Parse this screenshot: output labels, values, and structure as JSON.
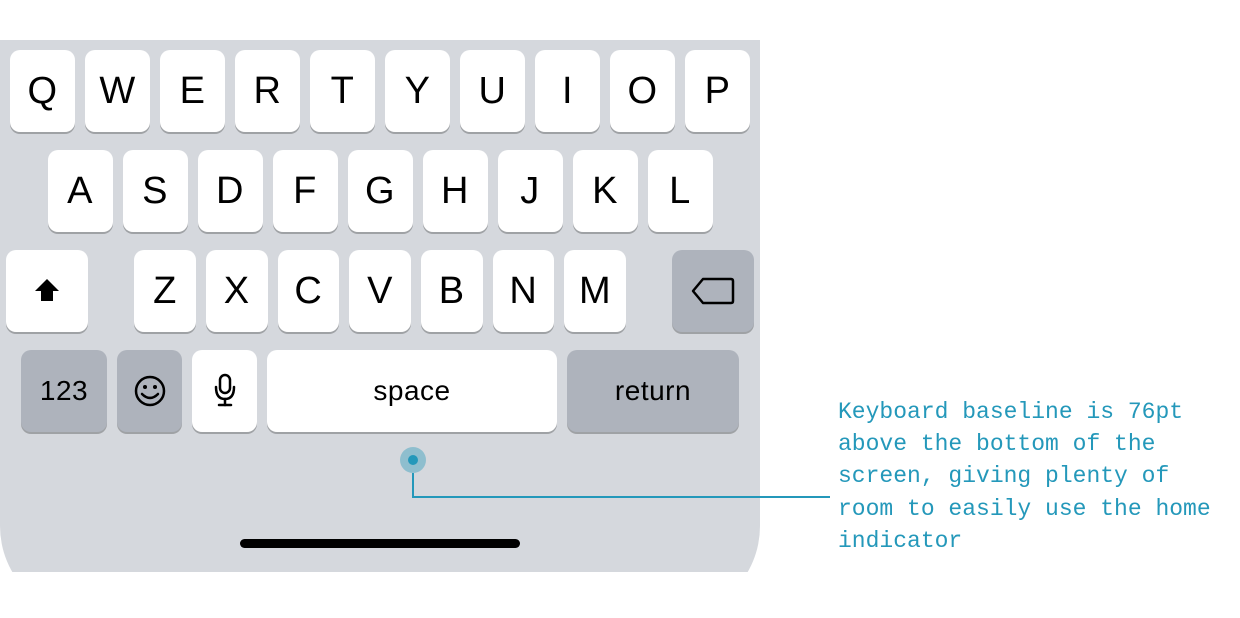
{
  "keyboard": {
    "row1": [
      "Q",
      "W",
      "E",
      "R",
      "T",
      "Y",
      "U",
      "I",
      "O",
      "P"
    ],
    "row2": [
      "A",
      "S",
      "D",
      "F",
      "G",
      "H",
      "J",
      "K",
      "L"
    ],
    "row3": [
      "Z",
      "X",
      "C",
      "V",
      "B",
      "N",
      "M"
    ],
    "numkey": "123",
    "space": "space",
    "return": "return"
  },
  "annotation": "Keyboard baseline is 76pt above the bottom of the screen, giving plenty of room to easily use the home indicator"
}
